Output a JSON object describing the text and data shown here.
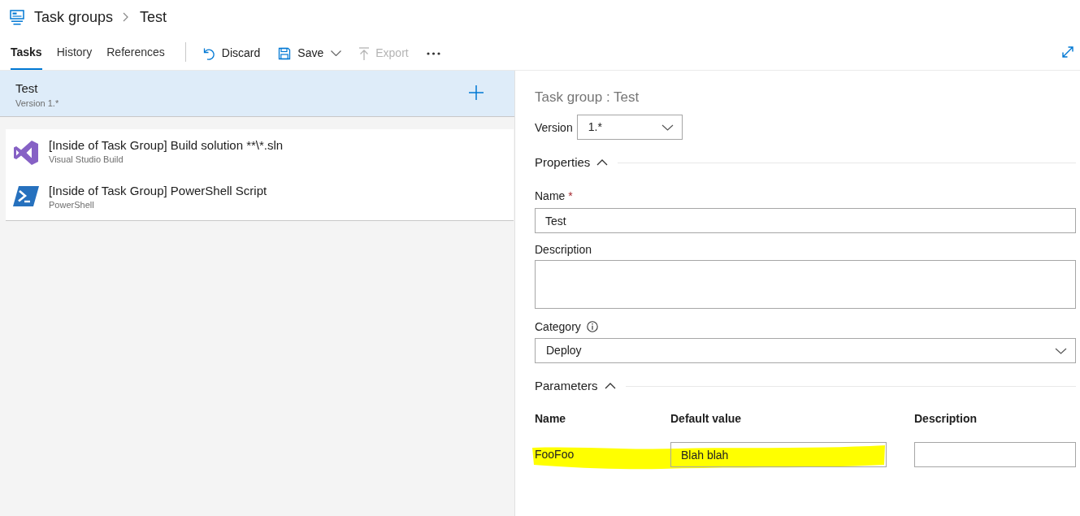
{
  "breadcrumb": {
    "items": [
      "Task groups",
      "Test"
    ]
  },
  "tabs": [
    {
      "label": "Tasks",
      "selected": true
    },
    {
      "label": "History",
      "selected": false
    },
    {
      "label": "References",
      "selected": false
    }
  ],
  "toolbar": [
    {
      "kind": "discard",
      "label": "Discard",
      "disabled": false,
      "dropdown": false
    },
    {
      "kind": "save",
      "label": "Save",
      "disabled": false,
      "dropdown": true
    },
    {
      "kind": "export",
      "label": "Export",
      "disabled": true,
      "dropdown": false
    },
    {
      "kind": "more",
      "disabled": false,
      "dropdown": false
    }
  ],
  "group": {
    "title": "Test",
    "subtitle": "Version 1.*"
  },
  "tasks": [
    {
      "kind": "visual-studio",
      "title": "[Inside of Task Group] Build solution **\\*.sln",
      "subtitle": "Visual Studio Build"
    },
    {
      "kind": "powershell",
      "title": "[Inside of Task Group] PowerShell Script",
      "subtitle": "PowerShell"
    }
  ],
  "details": {
    "title": "Task group : Test",
    "version": {
      "label": "Version",
      "value": "1.*"
    },
    "properties": {
      "heading": "Properties",
      "expanded": true,
      "name": {
        "label": "Name",
        "required_mark": "*",
        "value": "Test"
      },
      "description": {
        "label": "Description"
      },
      "category": {
        "label": "Category",
        "value": "Deploy"
      }
    },
    "parameters": {
      "heading": "Parameters",
      "expanded": true,
      "columns": [
        "Name",
        "Default value",
        "Description"
      ],
      "rows": [
        {
          "name": "FooFoo",
          "default_value": "Blah blah",
          "highlighted": true
        }
      ]
    }
  }
}
